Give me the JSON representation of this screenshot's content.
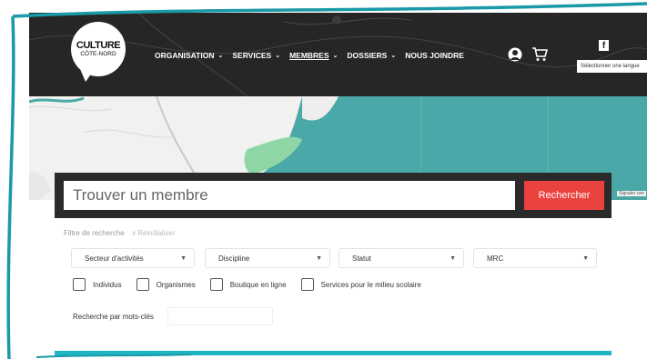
{
  "logo": {
    "line1": "CULTURE",
    "line2": "CÔTE-NORD"
  },
  "nav": [
    {
      "label": "ORGANISATION",
      "chevron": "⌄",
      "active": false
    },
    {
      "label": "SERVICES",
      "chevron": "⌄",
      "active": false
    },
    {
      "label": "MEMBRES",
      "chevron": "⌄",
      "active": true
    },
    {
      "label": "DOSSIERS",
      "chevron": "⌄",
      "active": false
    },
    {
      "label": "NOUS JOINDRE",
      "chevron": "",
      "active": false
    }
  ],
  "header_icons": [
    "user-icon",
    "cart-icon",
    "facebook-icon"
  ],
  "facebook_glyph": "f",
  "language_select": {
    "placeholder": "Sélectionner une langue"
  },
  "map_credit": "Signaler une",
  "search": {
    "placeholder": "Trouver un membre",
    "button_label": "Rechercher"
  },
  "filters": {
    "title": "Filtre de recherche",
    "reset_label": "x Réinitialiser",
    "selects": [
      {
        "label": "Secteur d'activités"
      },
      {
        "label": "Discipline"
      },
      {
        "label": "Statut"
      },
      {
        "label": "MRC"
      }
    ],
    "checkboxes": [
      {
        "label": "Individus",
        "checked": false
      },
      {
        "label": "Organismes",
        "checked": false
      },
      {
        "label": "Boutique en ligne",
        "checked": false
      },
      {
        "label": "Services pour le milieu scolaire",
        "checked": false
      }
    ],
    "keyword_label": "Recherche par mots-clés",
    "keyword_value": ""
  },
  "colors": {
    "header_bg": "#262626",
    "accent_red": "#e9423f",
    "map_water": "#4aa9a8",
    "border_teal": "#1a9aa8"
  }
}
